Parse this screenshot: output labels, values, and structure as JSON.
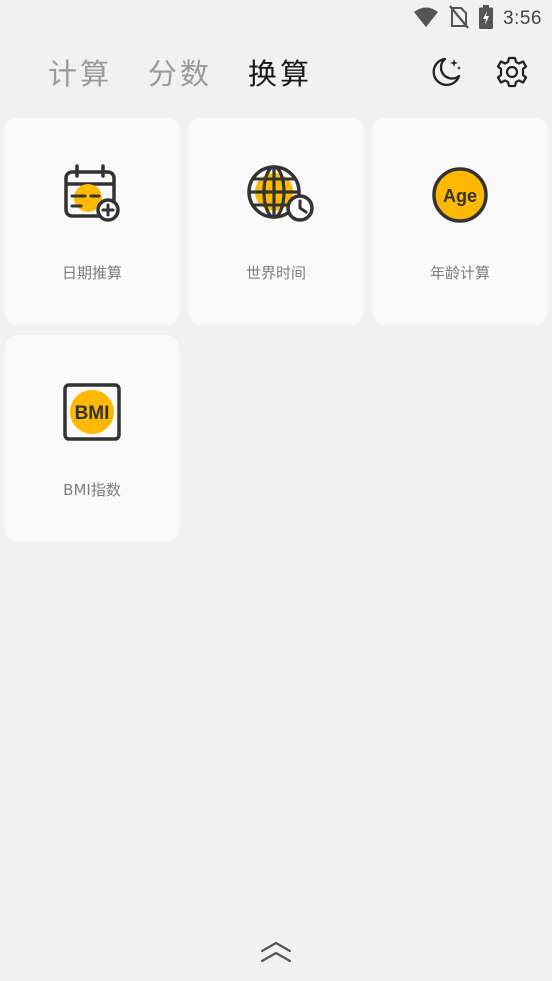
{
  "status_bar": {
    "time": "3:56",
    "icons": [
      "wifi-icon",
      "no-sim-icon",
      "battery-charging-icon"
    ]
  },
  "header": {
    "tabs": [
      {
        "label": "计算",
        "active": false
      },
      {
        "label": "分数",
        "active": false
      },
      {
        "label": "换算",
        "active": true
      }
    ],
    "actions": [
      "moon-stars-icon",
      "settings-gear-icon"
    ]
  },
  "cards": [
    {
      "label": "日期推算",
      "icon": "calendar-add-icon"
    },
    {
      "label": "世界时间",
      "icon": "globe-clock-icon"
    },
    {
      "label": "年龄计算",
      "icon": "age-badge-icon",
      "icon_text": "Age"
    },
    {
      "label": "BMI指数",
      "icon": "bmi-icon",
      "icon_text": "BMI"
    }
  ],
  "colors": {
    "accent": "#FFB900",
    "icon_stroke": "#333333",
    "background": "#F1F1F1",
    "card": "#FAFAFA"
  },
  "bottom": {
    "icon": "chevron-double-up-icon"
  }
}
